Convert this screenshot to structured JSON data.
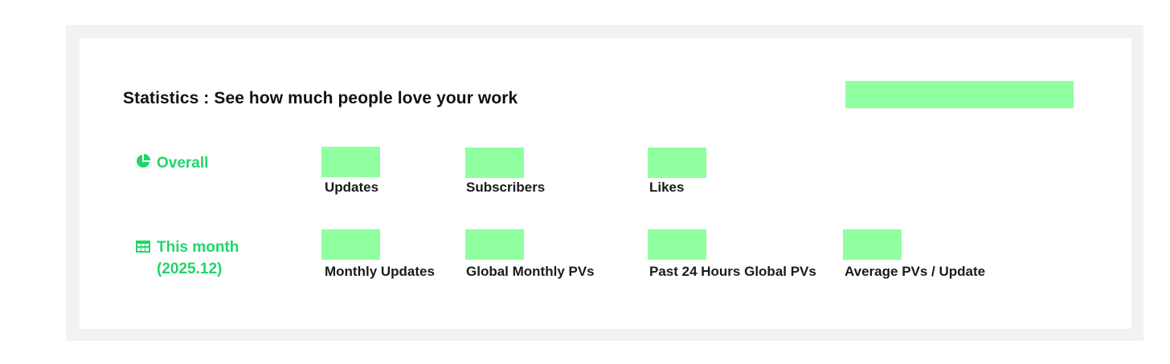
{
  "header": {
    "title": "Statistics : See how much people love your work",
    "redacted_box": ""
  },
  "colors": {
    "accent": "#1fd66a",
    "redaction": "#8fff9f",
    "frame": "#f2f2f2"
  },
  "overall": {
    "icon": "pie-chart-icon",
    "label": "Overall",
    "stats": [
      {
        "label": "Updates",
        "value": ""
      },
      {
        "label": "Subscribers",
        "value": ""
      },
      {
        "label": "Likes",
        "value": ""
      }
    ]
  },
  "this_month": {
    "icon": "table-icon",
    "label_line1": "This month",
    "label_line2": "(2025.12)",
    "stats": [
      {
        "label": "Monthly Updates",
        "value": ""
      },
      {
        "label": "Global Monthly PVs",
        "value": ""
      },
      {
        "label": "Past 24 Hours Global PVs",
        "value": ""
      },
      {
        "label": "Average PVs / Update",
        "value": ""
      }
    ]
  }
}
